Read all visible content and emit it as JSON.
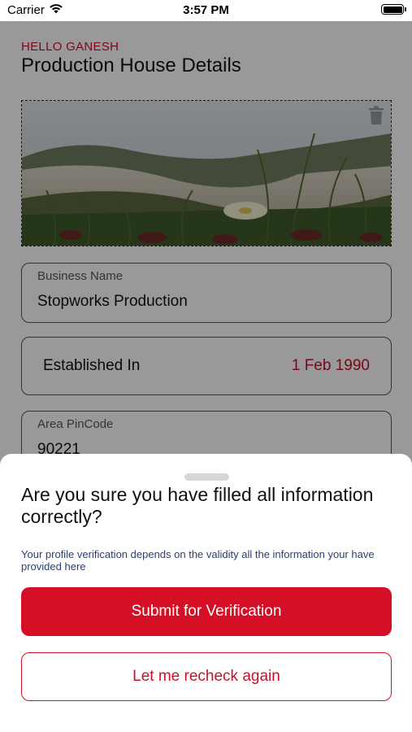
{
  "status_bar": {
    "carrier": "Carrier",
    "time": "3:57 PM"
  },
  "header": {
    "greeting": "HELLO GANESH",
    "title": "Production House Details"
  },
  "banner": {
    "icon": "trash-icon"
  },
  "form": {
    "business_name": {
      "label": "Business Name",
      "value": "Stopworks Production"
    },
    "established": {
      "label": "Established In",
      "value": "1 Feb 1990"
    },
    "pincode": {
      "label": "Area PinCode",
      "value": "90221"
    }
  },
  "sheet": {
    "title": "Are you sure you have filled all information correctly?",
    "description": "Your profile verification depends on the validity all the information your have provided here",
    "submit_label": "Submit for Verification",
    "recheck_label": "Let me recheck again"
  },
  "colors": {
    "accent": "#d50f26",
    "description_text": "#2b4170"
  }
}
